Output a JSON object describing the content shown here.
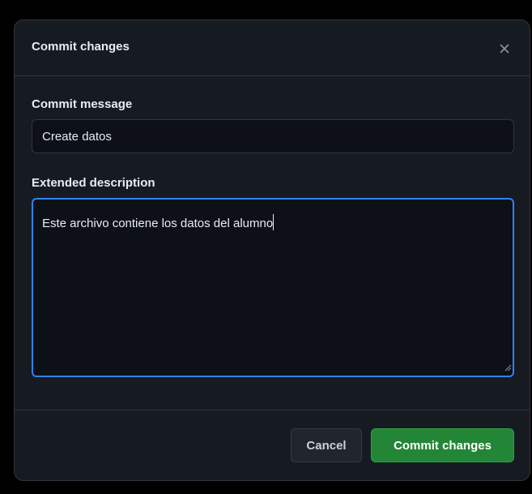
{
  "dialog": {
    "title": "Commit changes",
    "close_icon": "close-icon"
  },
  "commit_message": {
    "label": "Commit message",
    "value": "Create datos"
  },
  "extended_description": {
    "label": "Extended description",
    "value": "Este archivo contiene los datos del alumno"
  },
  "footer": {
    "cancel_label": "Cancel",
    "commit_label": "Commit changes"
  },
  "colors": {
    "background": "#0d1117",
    "dialog_background": "#161b22",
    "focus_border": "#2f81f7",
    "primary_button": "#238636"
  }
}
